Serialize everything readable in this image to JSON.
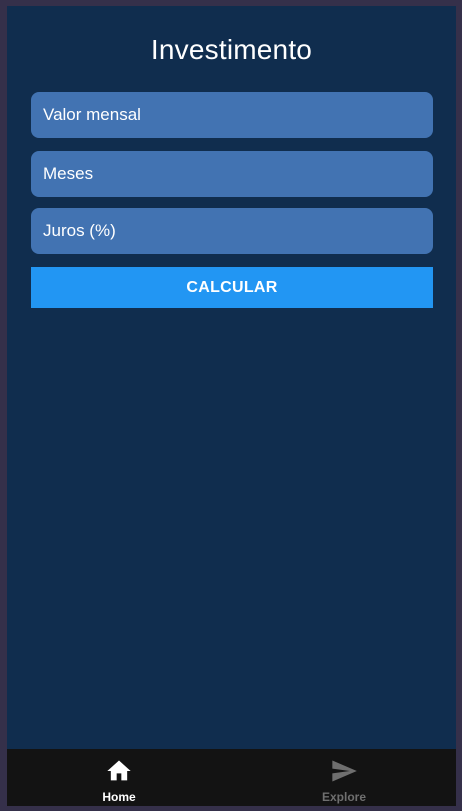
{
  "header": {
    "title": "Investimento"
  },
  "form": {
    "valor_mensal_placeholder": "Valor mensal",
    "meses_placeholder": "Meses",
    "juros_placeholder": "Juros (%)",
    "valor_mensal_value": "",
    "meses_value": "",
    "juros_value": "",
    "calculate_label": "CALCULAR"
  },
  "tabs": [
    {
      "label": "Home",
      "icon": "home-icon",
      "active": true
    },
    {
      "label": "Explore",
      "icon": "send-icon",
      "active": false
    }
  ],
  "colors": {
    "background": "#102d4e",
    "input": "#4273b2",
    "button": "#2296f3",
    "tabbar": "#131313",
    "inactive_tab": "#6f6f6f"
  }
}
